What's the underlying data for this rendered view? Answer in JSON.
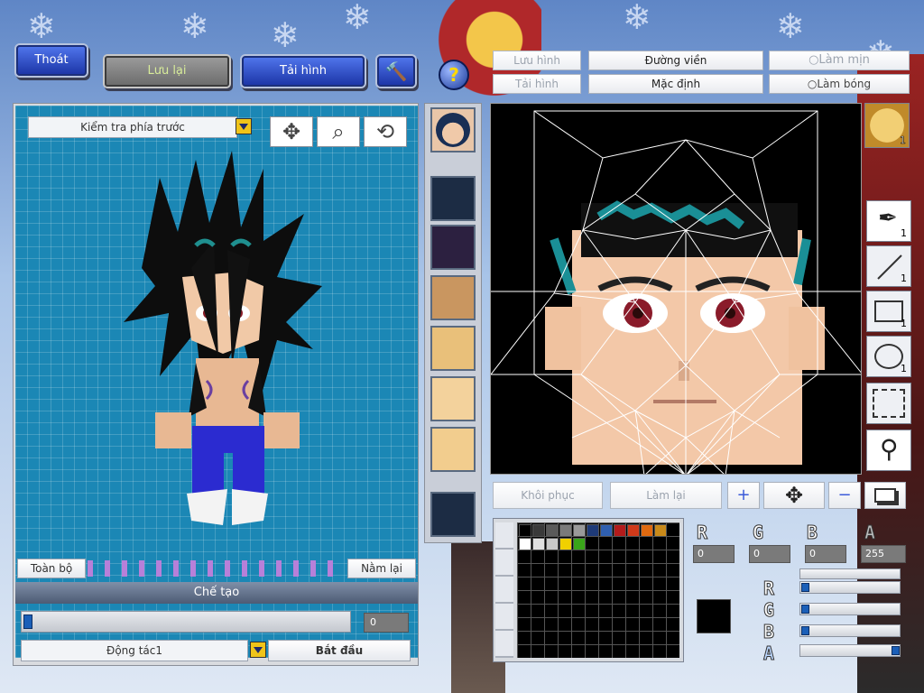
{
  "top_bar": {
    "exit_label": "Thoát",
    "save_label": "Lưu lại",
    "reload_label": "Tải hình"
  },
  "left_panel": {
    "view_select": "Kiểm tra phía trước",
    "all_label": "Toàn bộ",
    "lie_label": "Nằm lại",
    "create_title": "Chế tạo",
    "progress_value": "0",
    "action_select": "Động tác1",
    "start_label": "Bắt đầu"
  },
  "right_panel": {
    "save_image_label": "Lưu hình",
    "outline_label": "Đường viền",
    "smooth_label": "Làm mịn",
    "reload_image_label": "Tải hình",
    "default_label": "Mặc định",
    "shine_label": "Làm bóng",
    "restore_label": "Khôi phục",
    "redo_label": "Làm lại",
    "face_tool_count": "1",
    "pen_count": "1",
    "line_count": "1",
    "rect_count": "1",
    "ellipse_count": "1"
  },
  "color_panel": {
    "r_value": "0",
    "g_value": "0",
    "b_value": "0",
    "a_value": "255",
    "selected_color": "#000000",
    "r_level": 0,
    "g_level": 0,
    "b_level": 0,
    "a_level": 1
  }
}
